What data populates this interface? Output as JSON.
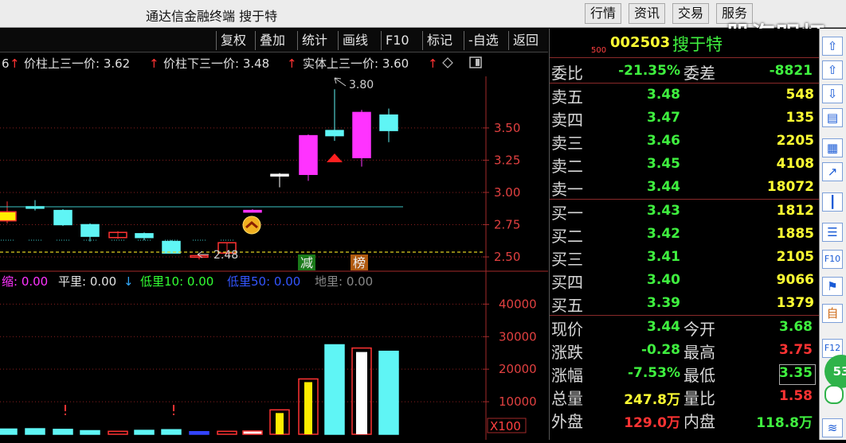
{
  "app": {
    "title": "通达信金融终端  搜于特",
    "watermark": "股海明灯",
    "top_buttons": [
      "行情",
      "资讯",
      "交易",
      "服务"
    ]
  },
  "toolbar": [
    "复权",
    "叠加",
    "统计",
    "画线",
    "F10",
    "标记",
    "-自选",
    "返回"
  ],
  "indicators": {
    "line1": [
      {
        "text": "6",
        "arrow": "↑",
        "color": "#e0e0e0"
      },
      {
        "text": "价柱上三一价: 3.62",
        "arrow": "↑",
        "color": "#e0e0e0"
      },
      {
        "text": "价柱下三一价: 3.48",
        "arrow": "↑",
        "color": "#e0e0e0"
      },
      {
        "text": "实体上三一价: 3.60",
        "arrow": "↑",
        "color": "#e0e0e0"
      }
    ],
    "line2": [
      {
        "text": "缩: 0.00",
        "color": "#ff33ff"
      },
      {
        "text": "平里: 0.00",
        "arrow": "↓",
        "color": "#e0e0e0"
      },
      {
        "text": "低里10: 0.00",
        "color": "#33ff33"
      },
      {
        "text": "低里50: 0.00",
        "color": "#3344ff"
      },
      {
        "text": "地里: 0.00",
        "color": "#888888"
      }
    ]
  },
  "chart_data": {
    "type": "candlestick",
    "y_ticks": [
      "3.50",
      "3.25",
      "3.00",
      "2.75",
      "2.50"
    ],
    "y_range": [
      2.42,
      3.9
    ],
    "volume_ticks": [
      "40000",
      "30000",
      "20000",
      "10000"
    ],
    "volume_unit": "X100",
    "high_label": "3.80",
    "low_label": "2.48",
    "markers": [
      {
        "text": "减",
        "bg": "#1a7a1a"
      },
      {
        "text": "榜",
        "bg": "#b05a10"
      }
    ],
    "candles": [
      {
        "o": 2.78,
        "c": 2.85,
        "h": 2.93,
        "l": 2.76,
        "style": "yellow-box"
      },
      {
        "o": 2.89,
        "c": 2.88,
        "h": 2.94,
        "l": 2.86,
        "style": "cyan-fill"
      },
      {
        "o": 2.86,
        "c": 2.75,
        "h": 2.87,
        "l": 2.74,
        "style": "cyan-fill"
      },
      {
        "o": 2.75,
        "c": 2.66,
        "h": 2.76,
        "l": 2.62,
        "style": "cyan-fill"
      },
      {
        "o": 2.65,
        "c": 2.69,
        "h": 2.7,
        "l": 2.64,
        "style": "red-box"
      },
      {
        "o": 2.68,
        "c": 2.65,
        "h": 2.69,
        "l": 2.63,
        "style": "cyan-fill"
      },
      {
        "o": 2.62,
        "c": 2.53,
        "h": 2.63,
        "l": 2.53,
        "style": "cyan-fill"
      },
      {
        "o": 2.5,
        "c": 2.51,
        "h": 2.52,
        "l": 2.48,
        "style": "red-box"
      },
      {
        "o": 2.53,
        "c": 2.61,
        "h": 2.61,
        "l": 2.52,
        "style": "red-box"
      },
      {
        "o": 2.86,
        "c": 2.86,
        "h": 2.87,
        "l": 2.85,
        "style": "magenta-line"
      },
      {
        "o": 3.14,
        "c": 3.14,
        "h": 3.15,
        "l": 3.04,
        "style": "white-line"
      },
      {
        "o": 3.14,
        "c": 3.44,
        "h": 3.45,
        "l": 3.09,
        "style": "magenta-fill"
      },
      {
        "o": 3.44,
        "c": 3.48,
        "h": 3.8,
        "l": 3.4,
        "style": "cyan-fill"
      },
      {
        "o": 3.27,
        "c": 3.62,
        "h": 3.64,
        "l": 3.2,
        "style": "magenta-fill"
      },
      {
        "o": 3.6,
        "c": 3.48,
        "h": 3.65,
        "l": 3.39,
        "style": "cyan-fill"
      }
    ],
    "volumes": [
      {
        "v": 1600,
        "style": "cyan-fill"
      },
      {
        "v": 1700,
        "style": "cyan-fill"
      },
      {
        "v": 1500,
        "style": "cyan-fill"
      },
      {
        "v": 1100,
        "style": "cyan-fill"
      },
      {
        "v": 900,
        "style": "red-box"
      },
      {
        "v": 1200,
        "style": "cyan-fill"
      },
      {
        "v": 1400,
        "style": "cyan-fill"
      },
      {
        "v": 800,
        "style": "blue-fill"
      },
      {
        "v": 900,
        "style": "red-box"
      },
      {
        "v": 1000,
        "style": "white-line"
      },
      {
        "v": 7500,
        "style": "yellow-box"
      },
      {
        "v": 17000,
        "style": "yellow-box"
      },
      {
        "v": 27500,
        "style": "cyan-fill"
      },
      {
        "v": 26500,
        "style": "white-redbox"
      },
      {
        "v": 25500,
        "style": "cyan-fill"
      }
    ]
  },
  "quote": {
    "code": "002503",
    "name": "搜于特",
    "small_tag": "500",
    "wei_bi_label": "委比",
    "wei_bi": "-21.35%",
    "wei_cha_label": "委差",
    "wei_cha": "-8821",
    "sell": [
      {
        "label": "卖五",
        "price": "3.48",
        "vol": "548"
      },
      {
        "label": "卖四",
        "price": "3.47",
        "vol": "135"
      },
      {
        "label": "卖三",
        "price": "3.46",
        "vol": "2205"
      },
      {
        "label": "卖二",
        "price": "3.45",
        "vol": "4108"
      },
      {
        "label": "卖一",
        "price": "3.44",
        "vol": "18072"
      }
    ],
    "buy": [
      {
        "label": "买一",
        "price": "3.43",
        "vol": "1812"
      },
      {
        "label": "买二",
        "price": "3.42",
        "vol": "1885"
      },
      {
        "label": "买三",
        "price": "3.41",
        "vol": "2105"
      },
      {
        "label": "买四",
        "price": "3.40",
        "vol": "9066"
      },
      {
        "label": "买五",
        "price": "3.39",
        "vol": "1379"
      }
    ],
    "stats_left": [
      {
        "label": "现价",
        "value": "3.44",
        "color": "#3ff03f"
      },
      {
        "label": "涨跌",
        "value": "-0.28",
        "color": "#3ff03f"
      },
      {
        "label": "涨幅",
        "value": "-7.53%",
        "color": "#3ff03f"
      },
      {
        "label": "总量",
        "value": "247.8万",
        "color": "#ffff33"
      },
      {
        "label": "外盘",
        "value": "129.0万",
        "color": "#ff3333"
      }
    ],
    "stats_right": [
      {
        "label": "今开",
        "value": "3.68",
        "color": "#3ff03f"
      },
      {
        "label": "最高",
        "value": "3.75",
        "color": "#ff3333"
      },
      {
        "label": "最低",
        "value": "3.35",
        "color": "#3ff03f"
      },
      {
        "label": "量比",
        "value": "1.58",
        "color": "#ff3333"
      },
      {
        "label": "内盘",
        "value": "118.8万",
        "color": "#3ff03f"
      }
    ]
  },
  "sidebar_icons": [
    "up-arrow-icon",
    "down-arrow-icon",
    "chart-icon",
    "grid-icon",
    "line-chart-icon",
    "candle-icon",
    "list-icon",
    "f10-icon",
    "info-icon",
    "self-icon",
    "f12-icon"
  ],
  "floating_badge": "53"
}
